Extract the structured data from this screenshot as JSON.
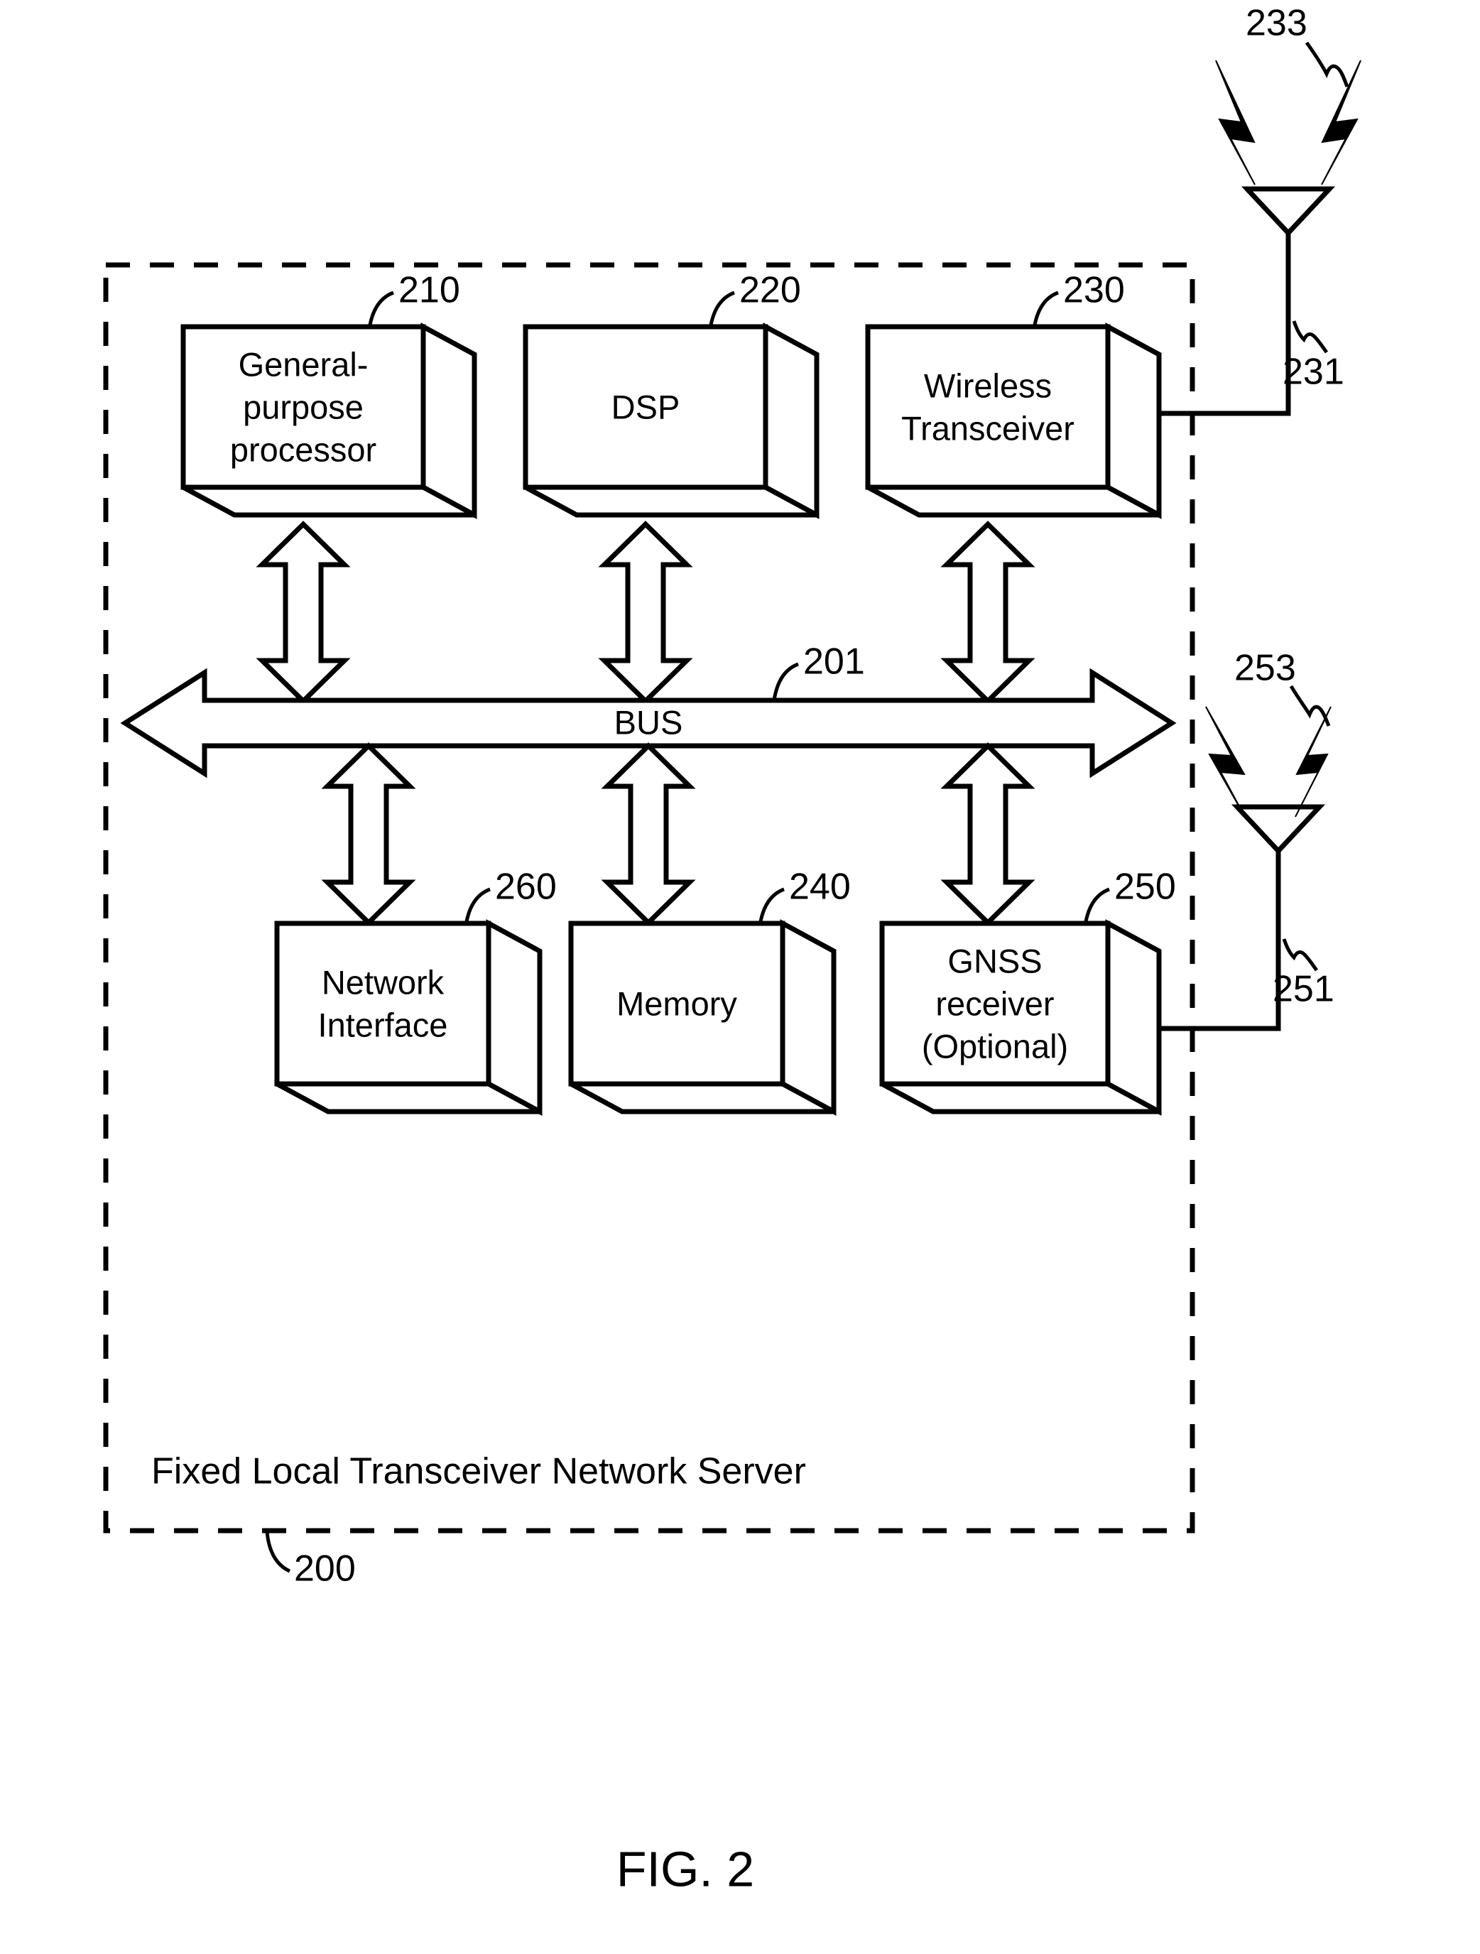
{
  "figure": {
    "caption": "FIG. 2",
    "enclosure_label": "Fixed Local Transceiver Network Server",
    "enclosure_ref": "200"
  },
  "bus": {
    "label": "BUS",
    "ref": "201"
  },
  "blocks": [
    {
      "id": "general-purpose-processor",
      "lines": [
        "General-",
        "purpose",
        "processor"
      ],
      "ref": "210"
    },
    {
      "id": "dsp",
      "lines": [
        "DSP"
      ],
      "ref": "220"
    },
    {
      "id": "wireless-transceiver",
      "lines": [
        "Wireless",
        "Transceiver"
      ],
      "ref": "230"
    },
    {
      "id": "network-interface",
      "lines": [
        "Network",
        "Interface"
      ],
      "ref": "260"
    },
    {
      "id": "memory",
      "lines": [
        "Memory"
      ],
      "ref": "240"
    },
    {
      "id": "gnss-receiver",
      "lines": [
        "GNSS",
        "receiver",
        "(Optional)"
      ],
      "ref": "250"
    }
  ],
  "antennas": [
    {
      "id": "wireless-antenna",
      "signal_ref": "233",
      "lead_ref": "231"
    },
    {
      "id": "gnss-antenna",
      "signal_ref": "253",
      "lead_ref": "251"
    }
  ],
  "colors": {
    "ink": "#000000",
    "paper": "#ffffff"
  }
}
